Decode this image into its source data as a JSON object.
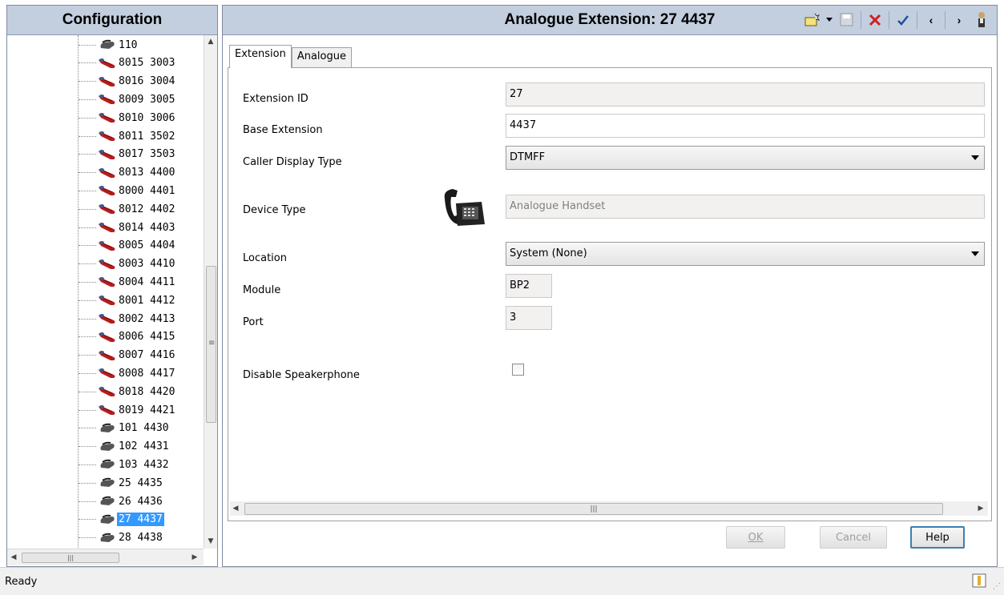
{
  "left_panel": {
    "title": "Configuration",
    "tree_items": [
      {
        "label": "110",
        "icon": "gray-phone-icon"
      },
      {
        "label": "8015 3003",
        "icon": "red-phone-icon"
      },
      {
        "label": "8016 3004",
        "icon": "red-phone-icon"
      },
      {
        "label": "8009 3005",
        "icon": "red-phone-icon"
      },
      {
        "label": "8010 3006",
        "icon": "red-phone-icon"
      },
      {
        "label": "8011 3502",
        "icon": "red-phone-icon"
      },
      {
        "label": "8017 3503",
        "icon": "red-phone-icon"
      },
      {
        "label": "8013 4400",
        "icon": "red-phone-icon"
      },
      {
        "label": "8000 4401",
        "icon": "red-phone-icon"
      },
      {
        "label": "8012 4402",
        "icon": "red-phone-icon"
      },
      {
        "label": "8014 4403",
        "icon": "red-phone-icon"
      },
      {
        "label": "8005 4404",
        "icon": "red-phone-icon"
      },
      {
        "label": "8003 4410",
        "icon": "red-phone-icon"
      },
      {
        "label": "8004 4411",
        "icon": "red-phone-icon"
      },
      {
        "label": "8001 4412",
        "icon": "red-phone-icon"
      },
      {
        "label": "8002 4413",
        "icon": "red-phone-icon"
      },
      {
        "label": "8006 4415",
        "icon": "red-phone-icon"
      },
      {
        "label": "8007 4416",
        "icon": "red-phone-icon"
      },
      {
        "label": "8008 4417",
        "icon": "red-phone-icon"
      },
      {
        "label": "8018 4420",
        "icon": "red-phone-icon"
      },
      {
        "label": "8019 4421",
        "icon": "red-phone-icon"
      },
      {
        "label": "101 4430",
        "icon": "gray-phone-icon"
      },
      {
        "label": "102 4431",
        "icon": "gray-phone-icon"
      },
      {
        "label": "103 4432",
        "icon": "gray-phone-icon"
      },
      {
        "label": "25 4435",
        "icon": "gray-phone-icon"
      },
      {
        "label": "26 4436",
        "icon": "gray-phone-icon"
      },
      {
        "label": "27 4437",
        "icon": "gray-phone-icon",
        "selected": true
      },
      {
        "label": "28 4438",
        "icon": "gray-phone-icon"
      }
    ]
  },
  "right_panel": {
    "title": "Analogue Extension: 27 4437",
    "toolbar": [
      "new-icon",
      "dropdown-arrow-icon",
      "save-icon",
      "delete-icon",
      "validate-icon",
      "previous-icon",
      "next-icon",
      "user-icon"
    ],
    "tabs": [
      {
        "label": "Extension",
        "active": true
      },
      {
        "label": "Analogue",
        "active": false
      }
    ],
    "form": {
      "extension_id": {
        "label": "Extension ID",
        "value": "27"
      },
      "base_extension": {
        "label": "Base Extension",
        "value": "4437"
      },
      "caller_display_type": {
        "label": "Caller Display Type",
        "value": "DTMFF"
      },
      "device_type": {
        "label": "Device Type",
        "value": "Analogue Handset"
      },
      "location": {
        "label": "Location",
        "value": "System (None)"
      },
      "module": {
        "label": "Module",
        "value": "BP2"
      },
      "port": {
        "label": "Port",
        "value": "3"
      },
      "disable_speakerphone": {
        "label": "Disable Speakerphone",
        "checked": false
      }
    },
    "buttons": {
      "ok": "OK",
      "cancel": "Cancel",
      "help": "Help"
    }
  },
  "statusbar": {
    "text": "Ready"
  }
}
